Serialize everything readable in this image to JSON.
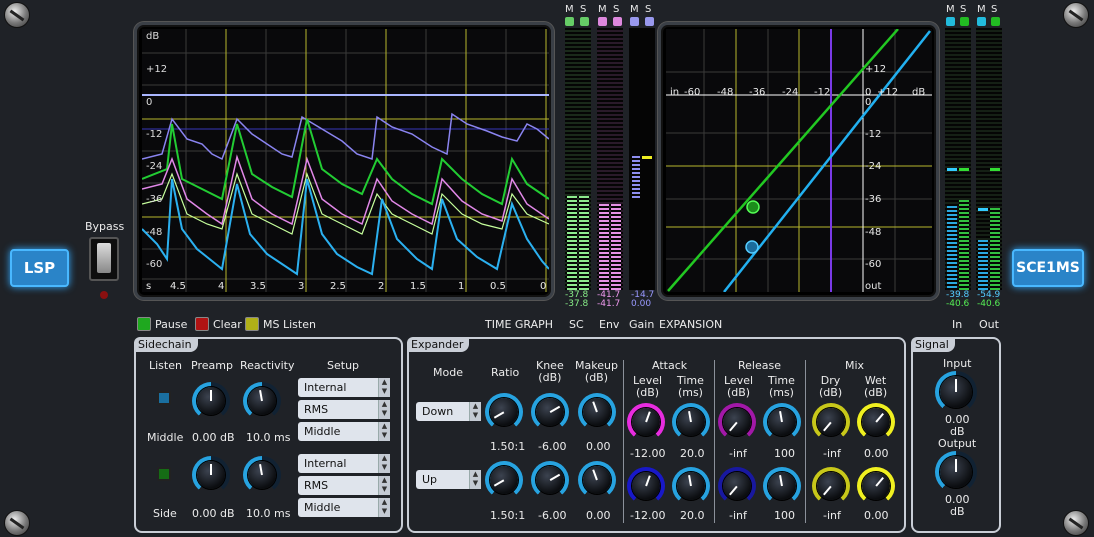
{
  "app": {
    "logo": "LSP",
    "plugin": "SCE1MS",
    "bypass_label": "Bypass"
  },
  "time_graph": {
    "y_labels": [
      "dB",
      "+12",
      "0",
      "-12",
      "-24",
      "-36",
      "-48",
      "-60"
    ],
    "x_labels": [
      "s",
      "4.5",
      "4",
      "3.5",
      "3",
      "2.5",
      "2",
      "1.5",
      "1",
      "0.5",
      "0"
    ]
  },
  "transfer_graph": {
    "x_labels": [
      "in",
      "-60",
      "-48",
      "-36",
      "-24",
      "-12",
      "0",
      "+12",
      "dB"
    ],
    "y_labels": [
      "+12",
      "0",
      "-12",
      "-24",
      "-36",
      "-48",
      "-60",
      "out"
    ]
  },
  "meters": {
    "ms_labels": [
      "M",
      "S"
    ],
    "sc": {
      "m": "-37.8",
      "s": "-37.8"
    },
    "env": {
      "m": "-41.7",
      "s": "-41.7"
    },
    "gain": {
      "m": "-14.7",
      "s": "0.00"
    },
    "in": {
      "m": "-39.8",
      "s": "-40.6"
    },
    "out": {
      "m": "-54.9",
      "s": "-40.6"
    },
    "labels": {
      "time": "TIME GRAPH",
      "sc": "SC",
      "env": "Env",
      "gain": "Gain",
      "expansion": "EXPANSION",
      "in": "In",
      "out": "Out"
    }
  },
  "legend": {
    "pause": "Pause",
    "clear": "Clear",
    "ms_listen": "MS Listen",
    "colors": {
      "pause": "#1fa81f",
      "clear": "#b01313",
      "ms": "#b0b018"
    }
  },
  "sidechain": {
    "title": "Sidechain",
    "headers": {
      "listen": "Listen",
      "preamp": "Preamp",
      "reactivity": "Reactivity",
      "setup": "Setup"
    },
    "rows": [
      {
        "name": "Middle",
        "preamp": "0.00 dB",
        "reactivity": "10.0 ms",
        "setup": [
          "Internal",
          "RMS",
          "Middle"
        ]
      },
      {
        "name": "Side",
        "preamp": "0.00 dB",
        "reactivity": "10.0 ms",
        "setup": [
          "Internal",
          "RMS",
          "Middle"
        ]
      }
    ]
  },
  "expander": {
    "title": "Expander",
    "headers": {
      "mode": "Mode",
      "ratio": "Ratio",
      "knee": "Knee\n(dB)",
      "makeup": "Makeup\n(dB)",
      "attack": "Attack",
      "release": "Release",
      "mix": "Mix",
      "level": "Level\n(dB)",
      "time": "Time\n(ms)",
      "dry": "Dry\n(dB)",
      "wet": "Wet\n(dB)"
    },
    "rows": [
      {
        "mode": "Down",
        "ratio": "1.50:1",
        "knee": "-6.00",
        "makeup": "0.00",
        "att_level": "-12.00",
        "att_time": "20.0",
        "rel_level": "-inf",
        "rel_time": "100",
        "dry": "-inf",
        "wet": "0.00"
      },
      {
        "mode": "Up",
        "ratio": "1.50:1",
        "knee": "-6.00",
        "makeup": "0.00",
        "att_level": "-12.00",
        "att_time": "20.0",
        "rel_level": "-inf",
        "rel_time": "100",
        "dry": "-inf",
        "wet": "0.00"
      }
    ]
  },
  "signal": {
    "title": "Signal",
    "input_label": "Input",
    "input_value": "0.00",
    "input_unit": "dB",
    "output_label": "Output",
    "output_value": "0.00",
    "output_unit": "dB"
  }
}
